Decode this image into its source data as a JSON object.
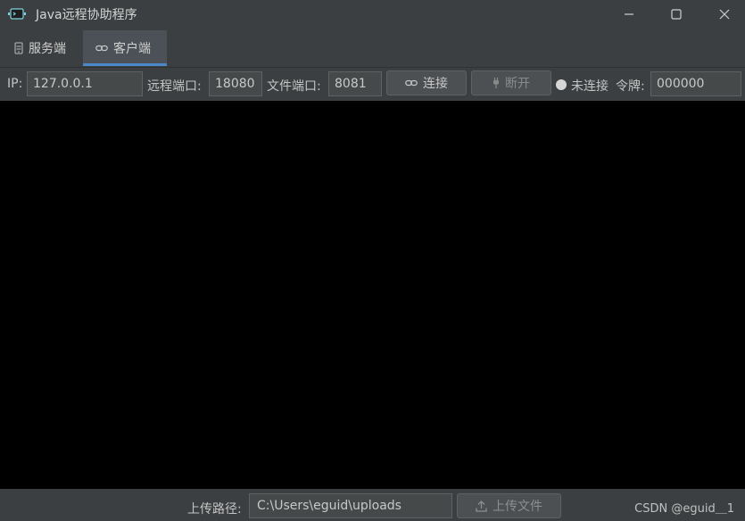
{
  "window": {
    "title": "Java远程协助程序",
    "app_icon": "terminal-app-icon",
    "controls": {
      "minimize": "minimize-icon",
      "maximize": "maximize-icon",
      "close": "close-icon"
    }
  },
  "tabs": [
    {
      "label": "服务端",
      "icon": "server-icon",
      "selected": false
    },
    {
      "label": "客户端",
      "icon": "link-icon",
      "selected": true
    }
  ],
  "toolbar": {
    "ip_label": "IP:",
    "ip_value": "127.0.0.1",
    "remote_port_label": "远程端口:",
    "remote_port_value": "18080",
    "file_port_label": "文件端口:",
    "file_port_value": "8081",
    "connect_label": "连接",
    "disconnect_label": "断开",
    "status_text": "未连接",
    "token_label": "令牌:",
    "token_value": "000000"
  },
  "bottom": {
    "upload_path_label": "上传路径:",
    "upload_path_value": "C:\\Users\\eguid\\uploads",
    "upload_button_label": "上传文件",
    "watermark": "CSDN @eguid＿1"
  },
  "colors": {
    "background": "#3c3f41",
    "accent": "#4a88c7",
    "canvas": "#000000",
    "status_dot": "#d6d6d6"
  }
}
